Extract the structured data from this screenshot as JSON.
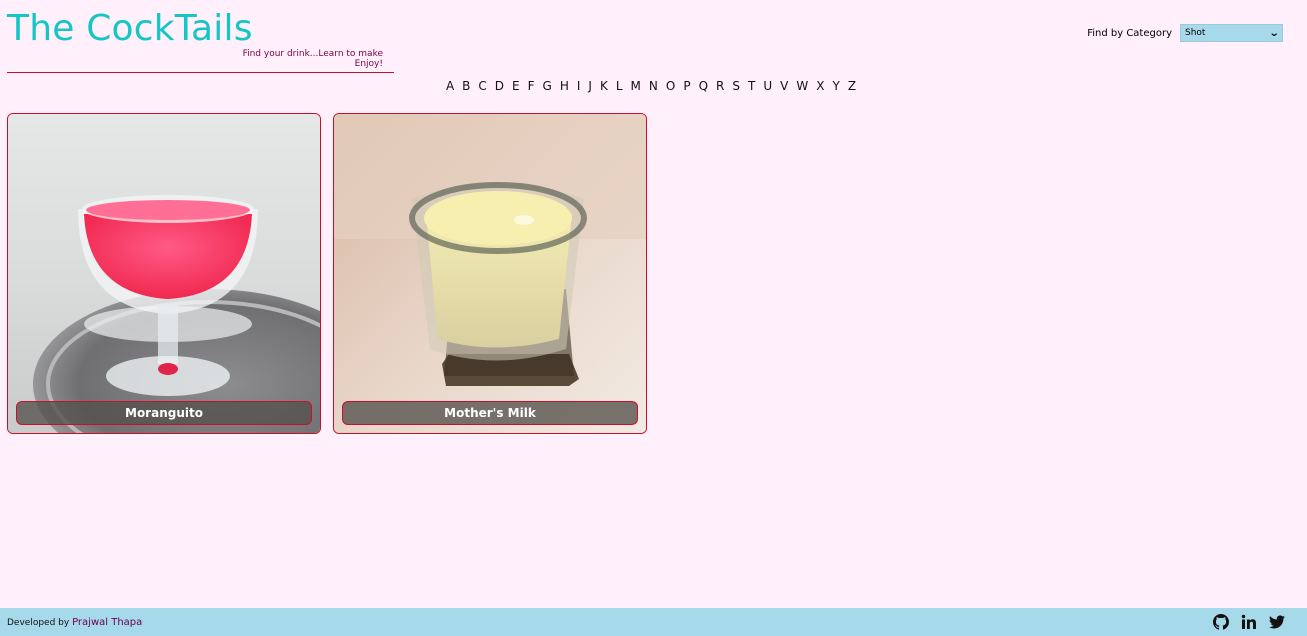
{
  "header": {
    "title": "The CockTails",
    "tagline_line1": "Find your drink...Learn to make",
    "tagline_line2": "Enjoy!"
  },
  "category": {
    "label": "Find by Category",
    "selected": "Shot"
  },
  "letters": [
    "A",
    "B",
    "C",
    "D",
    "E",
    "F",
    "G",
    "H",
    "I",
    "J",
    "K",
    "L",
    "M",
    "N",
    "O",
    "P",
    "Q",
    "R",
    "S",
    "T",
    "U",
    "V",
    "W",
    "X",
    "Y",
    "Z"
  ],
  "cards": [
    {
      "name": "Moranguito"
    },
    {
      "name": "Mother's Milk"
    }
  ],
  "footer": {
    "developed_by": "Developed by",
    "author": "Prajwal Thapa",
    "social": [
      "github-icon",
      "linkedin-icon",
      "twitter-icon"
    ]
  },
  "colors": {
    "background": "#fff0fb",
    "title": "#14c6c6",
    "accent_red": "#c8102e",
    "footer": "#a6d9e9"
  }
}
